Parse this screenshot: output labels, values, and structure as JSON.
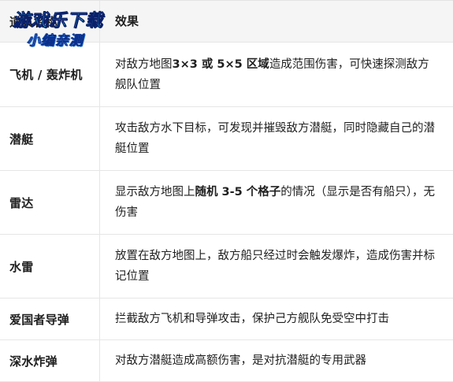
{
  "header": {
    "col1": "道具名称",
    "col2": "效果"
  },
  "rows": [
    {
      "name": "飞机 / 轰炸机",
      "desc_parts": [
        {
          "text": "对敌方地图",
          "bold": false
        },
        {
          "text": "3×3 或 5×5 区域",
          "bold": true
        },
        {
          "text": "造成范围伤害，可快速探测敌方舰队位置",
          "bold": false
        }
      ]
    },
    {
      "name": "潜艇",
      "desc_parts": [
        {
          "text": "攻击敌方水下目标，可发现并摧毁敌方潜艇，同时隐藏自己的潜艇位置",
          "bold": false
        }
      ]
    },
    {
      "name": "雷达",
      "desc_parts": [
        {
          "text": "显示敌方地图上",
          "bold": false
        },
        {
          "text": "随机 3-5 个格子",
          "bold": true
        },
        {
          "text": "的情况（显示是否有船只），无伤害",
          "bold": false
        }
      ]
    },
    {
      "name": "水雷",
      "desc_parts": [
        {
          "text": "放置在敌方地图上，敌方船只经过时会触发爆炸，造成伤害并标记位置",
          "bold": false
        }
      ]
    },
    {
      "name": "爱国者导弹",
      "desc_parts": [
        {
          "text": "拦截敌方飞机和导弹攻击，保护己方舰队免受空中打击",
          "bold": false
        }
      ]
    },
    {
      "name": "深水炸弹",
      "desc_parts": [
        {
          "text": "对敌方潜艇造成高额伤害，是对抗潜艇的专用武器",
          "bold": false
        }
      ]
    }
  ],
  "watermark": {
    "line1": "游戏乐下载",
    "line2": "小编亲测"
  }
}
